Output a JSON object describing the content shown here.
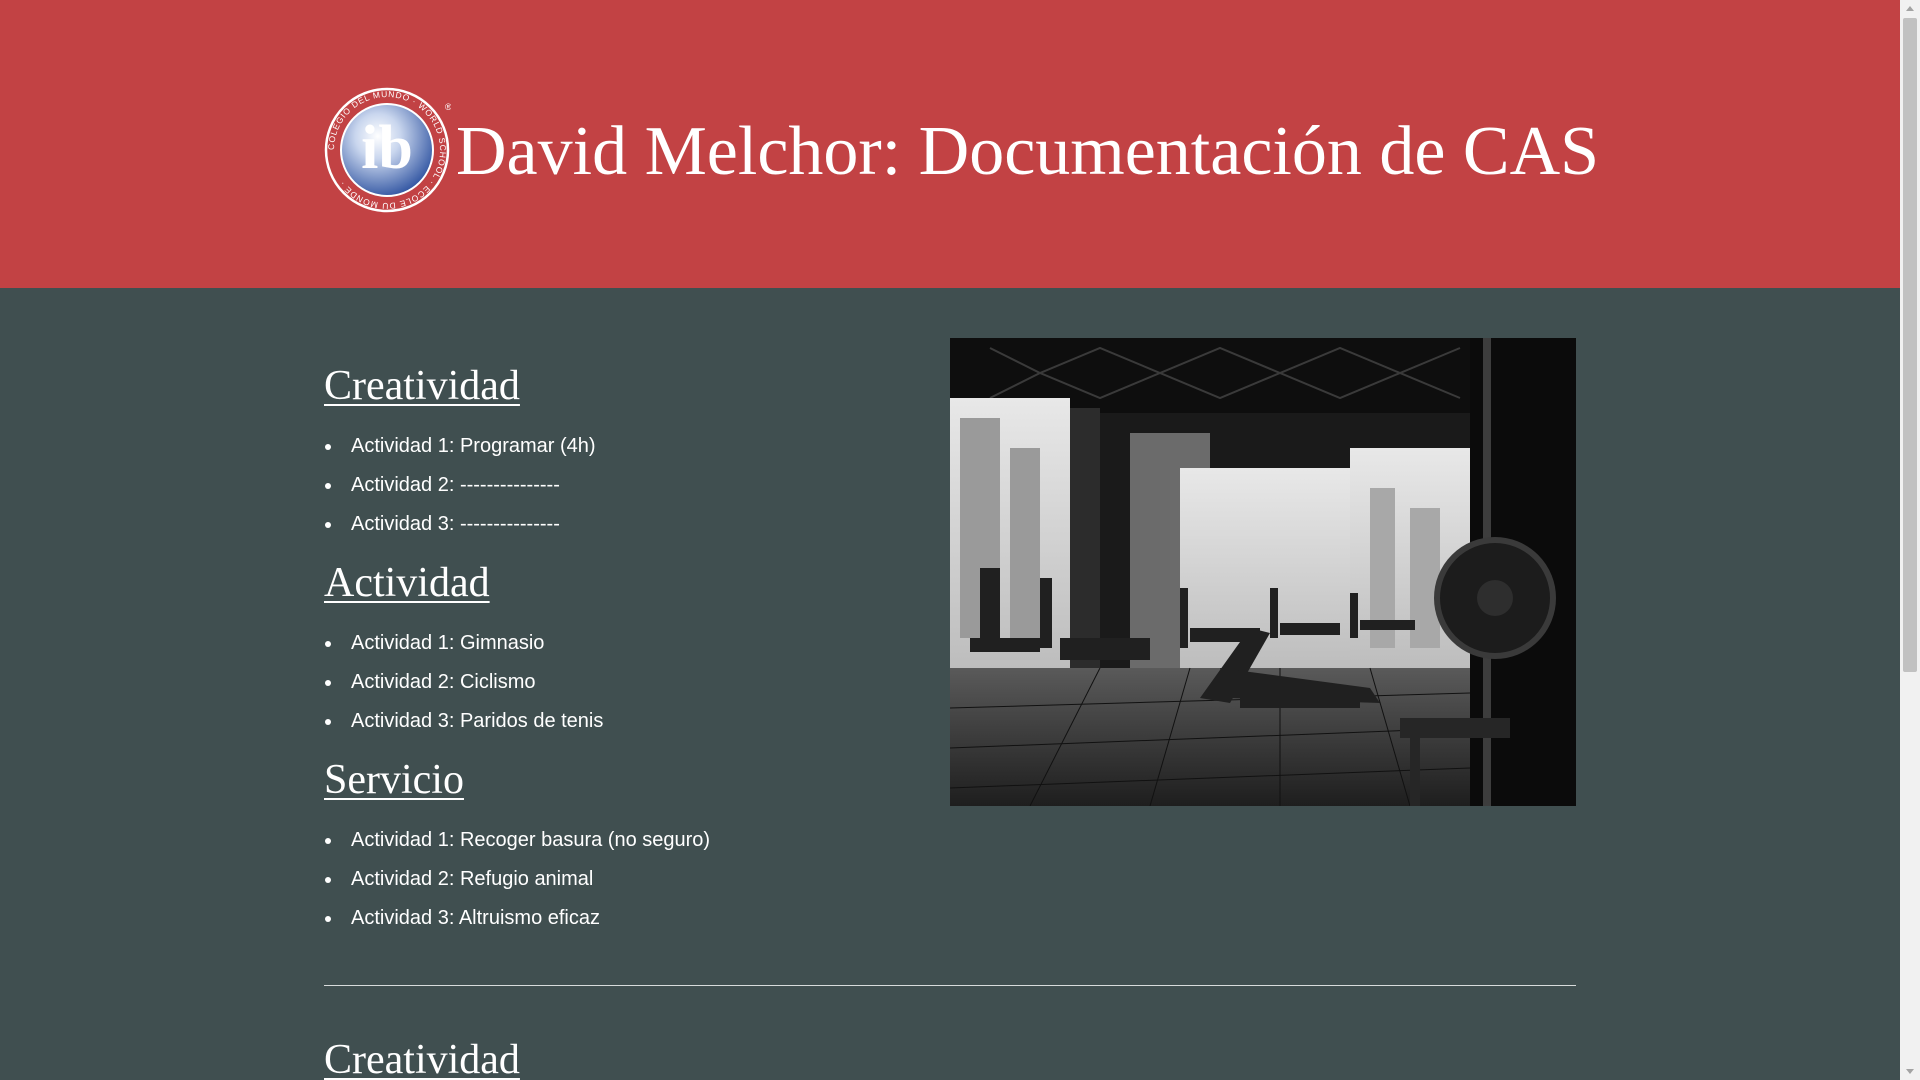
{
  "header": {
    "logo_text": "ib",
    "logo_ring_text": "COLEGIO DEL MUNDO · WORLD SCHOOL · ÉCOLE DU MONDE ·",
    "logo_mark": "®",
    "title": "David Melchor: Documentación de CAS"
  },
  "sections": [
    {
      "heading": "Creatividad",
      "items": [
        "Actividad 1: Programar (4h)",
        "Actividad 2: ---------------",
        "Actividad 3: ---------------"
      ]
    },
    {
      "heading": "Actividad",
      "items": [
        "Actividad 1: Gimnasio",
        "Actividad 2: Ciclismo",
        "Actividad 3: Paridos de tenis"
      ]
    },
    {
      "heading": "Servicio",
      "items": [
        "Actividad 1: Recoger basura (no seguro)",
        "Actividad 2: Refugio animal",
        "Actividad 3: Altruismo eficaz"
      ]
    }
  ],
  "next_section": {
    "heading": "Creatividad"
  },
  "colors": {
    "header_bg": "#c24244",
    "body_bg": "#404f50",
    "text": "#ffffff",
    "logo_blue": "#2a4f9e"
  },
  "icons": {
    "scroll_up": "triangle-up",
    "scroll_down": "triangle-down"
  }
}
